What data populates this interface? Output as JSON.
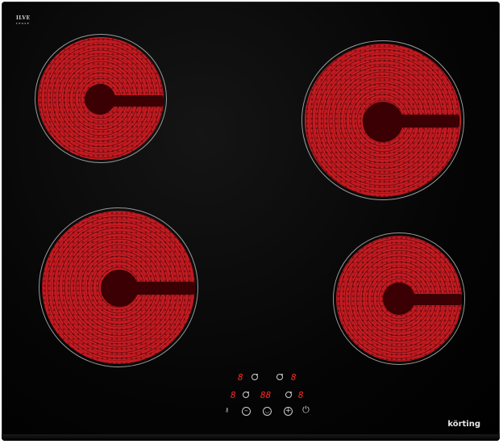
{
  "brand": {
    "logo_text": "ILVE",
    "logo_subtext": "ITALY",
    "name": "körting"
  },
  "display": {
    "top_left_digit": "8",
    "top_right_digit": "8",
    "mid_left_digit": "8",
    "mid_center_digits": "88",
    "mid_right_digit": "8"
  },
  "controls": {
    "lock_icon": "key-lock-icon",
    "minus_icon": "minus-icon",
    "timer_icon": "timer-icon",
    "plus_icon": "plus-icon",
    "power_icon": "power-icon"
  },
  "zones": [
    {
      "name": "front-left-zone"
    },
    {
      "name": "rear-right-zone"
    },
    {
      "name": "rear-left-zone"
    },
    {
      "name": "front-right-zone"
    }
  ],
  "colors": {
    "surface": "#000000",
    "heating": "#c41a20",
    "display": "#ff2a22"
  }
}
